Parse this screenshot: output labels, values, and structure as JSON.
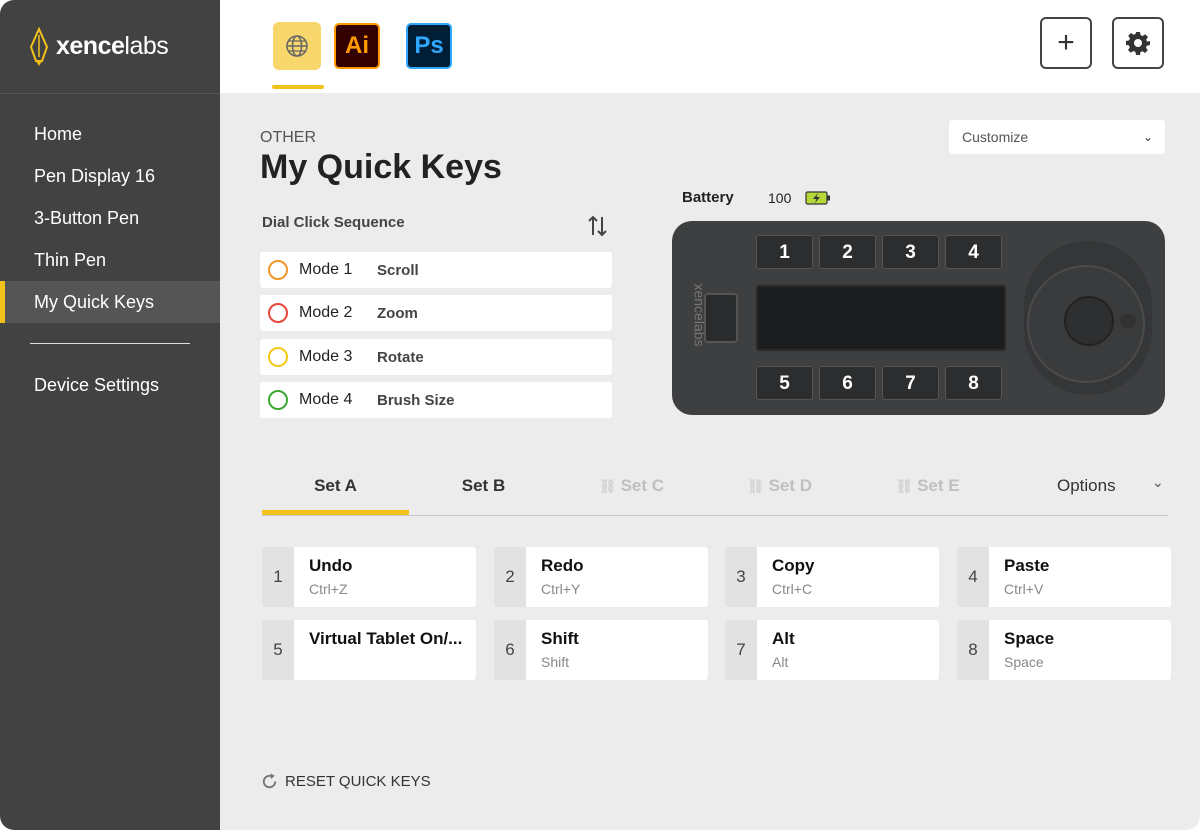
{
  "brand": {
    "bold": "xence",
    "light": "labs"
  },
  "sidebar": {
    "items": [
      {
        "label": "Home"
      },
      {
        "label": "Pen Display 16"
      },
      {
        "label": "3-Button Pen"
      },
      {
        "label": "Thin Pen"
      },
      {
        "label": "My Quick Keys",
        "active": true
      }
    ],
    "device_settings": "Device Settings"
  },
  "topbar": {
    "app_tabs": [
      {
        "name": "globe-icon",
        "selected": true
      },
      {
        "label": "Ai"
      },
      {
        "label": "Ps"
      }
    ],
    "add_label": "+"
  },
  "page": {
    "section": "OTHER",
    "title": "My Quick Keys",
    "customize": "Customize"
  },
  "dial": {
    "title": "Dial Click Sequence",
    "modes": [
      {
        "name": "Mode 1",
        "func": "Scroll",
        "color": "#f0962a"
      },
      {
        "name": "Mode 2",
        "func": "Zoom",
        "color": "#e8463a"
      },
      {
        "name": "Mode 3",
        "func": "Rotate",
        "color": "#f5c816"
      },
      {
        "name": "Mode 4",
        "func": "Brush Size",
        "color": "#3aaa35"
      }
    ]
  },
  "battery": {
    "label": "Battery",
    "value": "100",
    "color": "#b6d73a"
  },
  "device": {
    "keys_top": [
      "1",
      "2",
      "3",
      "4"
    ],
    "keys_bottom": [
      "5",
      "6",
      "7",
      "8"
    ],
    "brand": "xencelabs"
  },
  "sets": {
    "tabs": [
      {
        "label": "Set A",
        "active": true
      },
      {
        "label": "Set B"
      },
      {
        "label": "Set C",
        "disabled": true
      },
      {
        "label": "Set D",
        "disabled": true
      },
      {
        "label": "Set E",
        "disabled": true
      }
    ],
    "options": "Options"
  },
  "keys": [
    {
      "num": "1",
      "name": "Undo",
      "shortcut": "Ctrl+Z"
    },
    {
      "num": "2",
      "name": "Redo",
      "shortcut": "Ctrl+Y"
    },
    {
      "num": "3",
      "name": "Copy",
      "shortcut": "Ctrl+C"
    },
    {
      "num": "4",
      "name": "Paste",
      "shortcut": "Ctrl+V"
    },
    {
      "num": "5",
      "name": "Virtual Tablet On/...",
      "shortcut": ""
    },
    {
      "num": "6",
      "name": "Shift",
      "shortcut": "Shift"
    },
    {
      "num": "7",
      "name": "Alt",
      "shortcut": "Alt"
    },
    {
      "num": "8",
      "name": "Space",
      "shortcut": "Space"
    }
  ],
  "reset_label": "RESET QUICK KEYS",
  "accent": "#f2c21a"
}
